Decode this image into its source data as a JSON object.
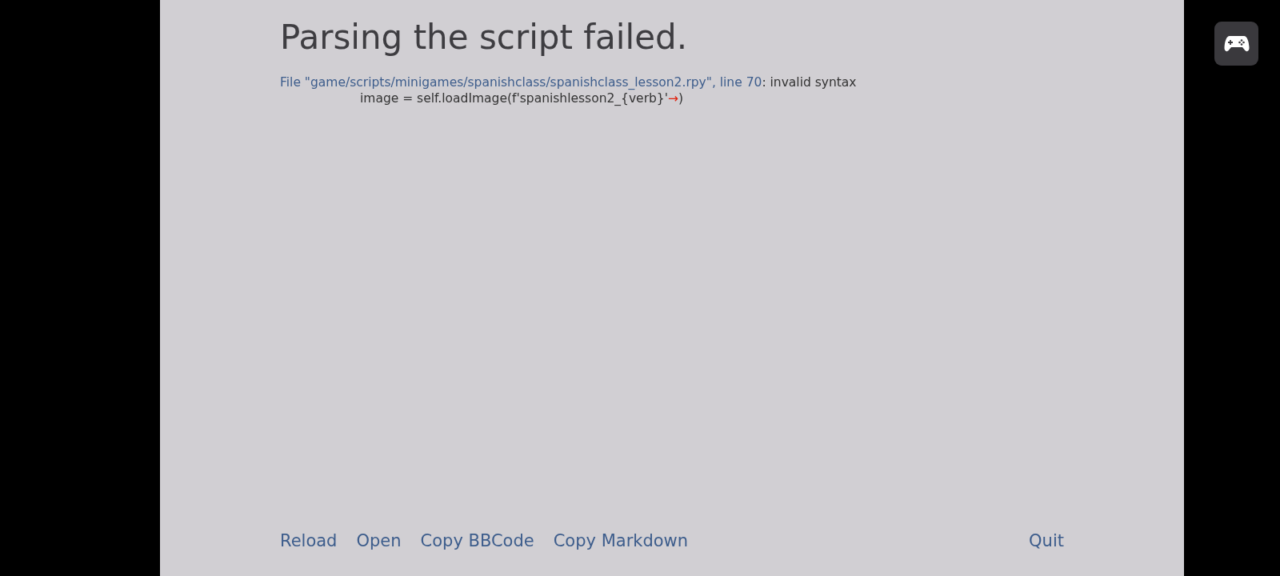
{
  "title": "Parsing the script failed.",
  "error": {
    "location": "File \"game/scripts/minigames/spanishclass/spanishclass_lesson2.rpy\", line 70",
    "message": ": invalid syntax",
    "code": {
      "before": "image = self.loadImage(f'spanishlesson2_{verb}'",
      "marker": "→",
      "after": ")"
    }
  },
  "actions": [
    {
      "label": "Reload"
    },
    {
      "label": "Open"
    },
    {
      "label": "Copy BBCode"
    },
    {
      "label": "Copy Markdown"
    }
  ],
  "quit": {
    "label": "Quit"
  }
}
